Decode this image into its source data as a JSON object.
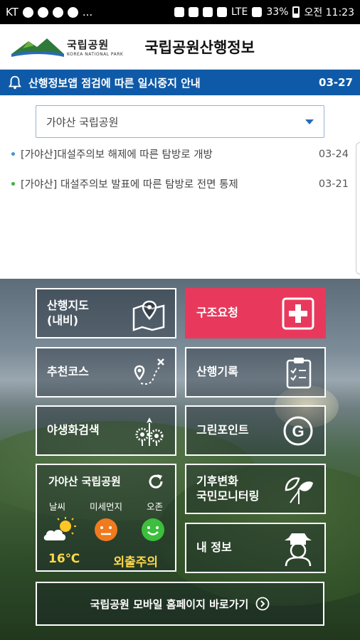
{
  "statusbar": {
    "carrier": "KT",
    "dots": "...",
    "network": "LTE",
    "battery": "33%",
    "time": "오전 11:23"
  },
  "header": {
    "logo_ko": "국립공원",
    "logo_en": "KOREA NATIONAL PARK",
    "title": "국립공원산행정보"
  },
  "notice": {
    "text": "산행정보앱 점검에 따른 일시중지 안내",
    "date": "03-27"
  },
  "park_select": {
    "selected": "가야산 국립공원"
  },
  "news": [
    {
      "text": "[가야산]대설주의보 해제에 따른 탐방로 개방",
      "date": "03-24"
    },
    {
      "text": "[가야산] 대설주의보 발표에 따른 탐방로 전면 통제",
      "date": "03-21"
    }
  ],
  "tiles": {
    "map_line1": "산행지도",
    "map_line2": "(내비)",
    "rescue": "구조요청",
    "course": "추천코스",
    "record": "산행기록",
    "flower": "야생화검색",
    "greenpoint": "그린포인트",
    "climate_line1": "기후변화",
    "climate_line2": "국민모니터링",
    "myinfo": "내 정보"
  },
  "weather": {
    "park": "가야산 국립공원",
    "label_weather": "날씨",
    "label_dust": "미세먼지",
    "label_ozone": "오존",
    "temperature": "16℃",
    "status": "외출주의"
  },
  "bottom": {
    "label": "국립공원 모바일 홈페이지 바로가기"
  },
  "colors": {
    "notice_bg": "#0f5aa8",
    "rescue_bg": "#e8395c",
    "dust_face": "#f07a1e",
    "ozone_face": "#3cbf3c",
    "highlight_text": "#ffd84a"
  }
}
